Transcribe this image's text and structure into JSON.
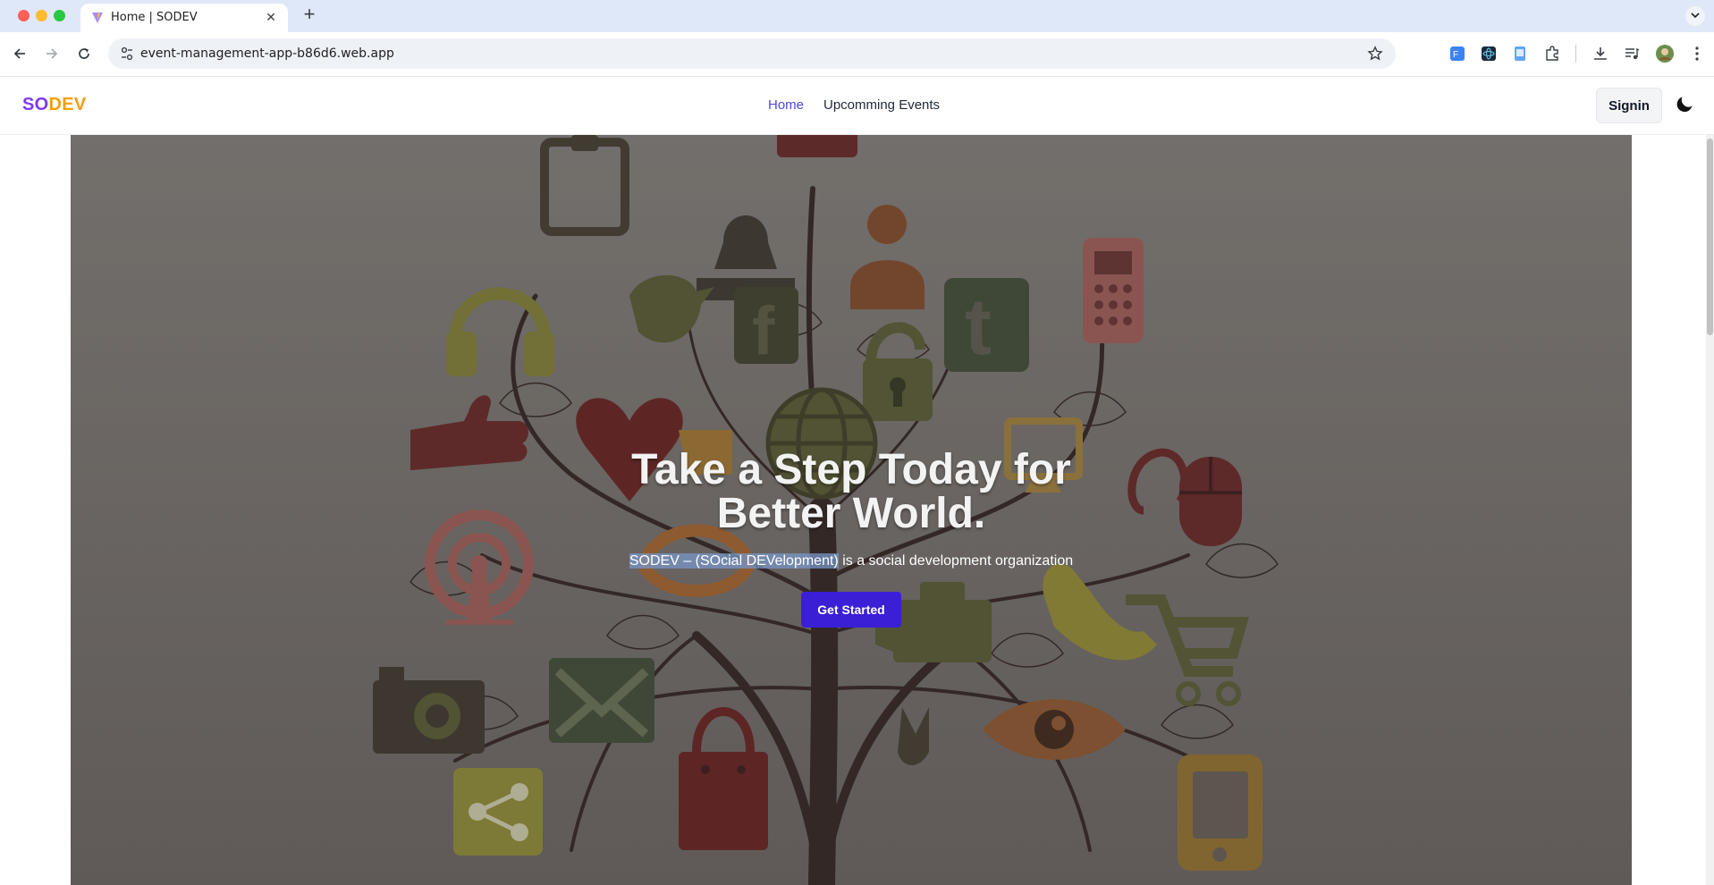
{
  "browser": {
    "tab_title": "Home | SODEV",
    "tab_close_glyph": "✕",
    "new_tab_glyph": "+",
    "url": "event-management-app-b86d6.web.app",
    "icons": [
      "back-icon",
      "forward-icon",
      "reload-icon",
      "site-info-icon",
      "bookmark-star-icon",
      "extension-icons",
      "download-icon",
      "media-icon",
      "profile-avatar",
      "kebab-menu-icon"
    ]
  },
  "site": {
    "logo_part1": "SO",
    "logo_part2": "DEV",
    "nav": [
      {
        "label": "Home",
        "active": true
      },
      {
        "label": "Upcomming Events",
        "active": false
      }
    ],
    "signin_label": "Signin",
    "theme_toggle_icon": "moon-icon",
    "colors": {
      "brand_purple": "#7c3aed",
      "brand_orange": "#f59e0b",
      "active_link": "#4f46e5",
      "cta": "#3b1fd6"
    }
  },
  "hero": {
    "title_line1": "Take a Step Today for",
    "title_line2": "Better World.",
    "subtitle_highlight": "SODEV – (SOcial DEVelopment)",
    "subtitle_rest": " is a social development organization",
    "cta_label": "Get Started"
  }
}
